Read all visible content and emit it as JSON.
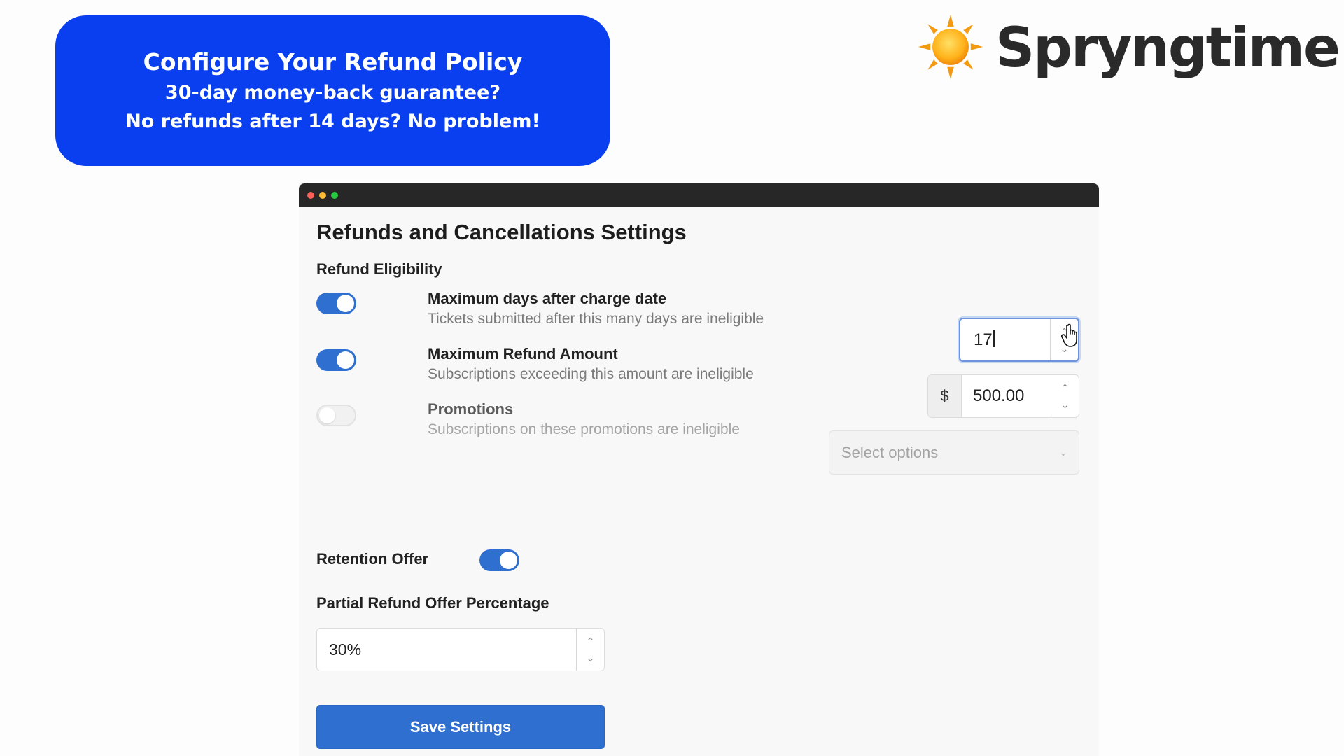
{
  "banner": {
    "line1": "Configure Your Refund Policy",
    "line2": "30-day money-back guarantee?",
    "line3": "No refunds after 14 days? No problem!",
    "color": "#0a3ff0"
  },
  "brand": {
    "name": "Spryngtime",
    "icon": "sun-icon"
  },
  "window": {
    "title": "Refunds and Cancellations Settings",
    "section": "Refund Eligibility",
    "rows": [
      {
        "label": "Maximum days after charge date",
        "description": "Tickets submitted after this many days are ineligible",
        "enabled": true,
        "value": "17"
      },
      {
        "label": "Maximum Refund Amount",
        "description": "Subscriptions exceeding this amount are ineligible",
        "enabled": true,
        "prefix": "$",
        "value": "500.00"
      },
      {
        "label": "Promotions",
        "description": "Subscriptions on these promotions are ineligible",
        "enabled": false,
        "placeholder": "Select options"
      }
    ],
    "retention": {
      "label": "Retention Offer",
      "enabled": true
    },
    "partial_refund": {
      "label": "Partial Refund Offer Percentage",
      "value": "30%"
    },
    "save_label": "Save Settings",
    "accent": "#2e6fd0"
  }
}
